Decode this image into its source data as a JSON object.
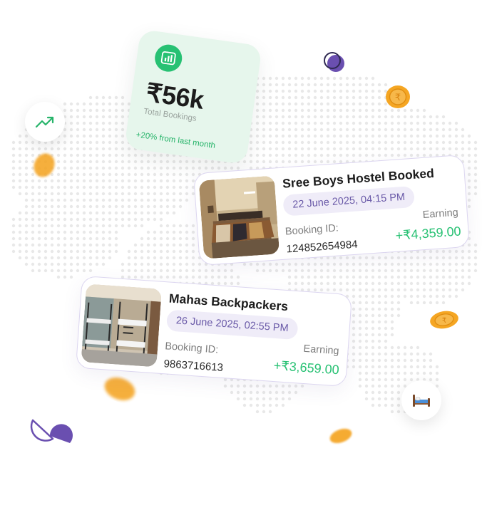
{
  "stat_card": {
    "value": "₹56k",
    "label": "Total Bookings",
    "change": "+20% from last month",
    "icon": "bar-chart-icon"
  },
  "bookings": [
    {
      "name": "Sree Boys Hostel Booked",
      "datetime": "22 June 2025, 04:15 PM",
      "id_label": "Booking ID:",
      "id_value": "124852654984",
      "earning_label": "Earning",
      "earning_value": "+₹4,359.00",
      "photo": "hostel-room-photo"
    },
    {
      "name": "Mahas Backpackers",
      "datetime": "26 June 2025, 02:55 PM",
      "id_label": "Booking ID:",
      "id_value": "9863716613",
      "earning_label": "Earning",
      "earning_value": "+₹3,659.00",
      "photo": "bunk-bed-dorm-photo"
    }
  ],
  "icons": {
    "trend": "trending-up-icon",
    "bed": "bed-icon",
    "coin": "rupee-coin-icon"
  },
  "colors": {
    "accent_green": "#27c173",
    "accent_purple": "#6a4fb0",
    "coin_gold": "#f5a623",
    "card_green_bg": "#e6f6ec"
  }
}
